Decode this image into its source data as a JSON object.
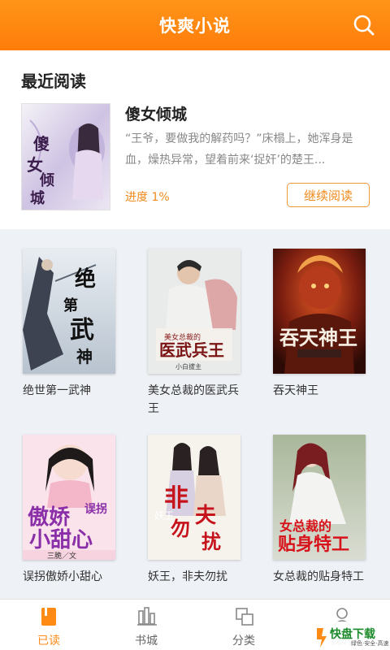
{
  "header": {
    "title": "快爽小说"
  },
  "recent": {
    "heading": "最近阅读",
    "book_title": "傻女倾城",
    "description": "“王爷，要做我的解药吗？”床榻上，她浑身是血，燥热异常，望着前来‘捉奸’的楚王...",
    "progress": "进度 1%",
    "continue_label": "继续阅读",
    "cover_text": "傻女倾城"
  },
  "books": [
    {
      "title": "绝世第一武神",
      "cover_text": "绝世第一武神"
    },
    {
      "title": "美女总裁的医武兵王",
      "cover_text": "医武兵王"
    },
    {
      "title": "吞天神王",
      "cover_text": "吞天神王"
    },
    {
      "title": "误拐傲娇小甜心",
      "cover_text": "傲娇小甜心"
    },
    {
      "title": "妖王，非夫勿扰",
      "cover_text": "非夫勿扰"
    },
    {
      "title": "女总裁的贴身特工",
      "cover_text": "女总裁的贴身特工"
    }
  ],
  "tabs": [
    {
      "label": "已读",
      "icon": "book-icon",
      "active": true
    },
    {
      "label": "书城",
      "icon": "bookshelf-icon",
      "active": false
    },
    {
      "label": "分类",
      "icon": "category-icon",
      "active": false
    },
    {
      "label": "我的",
      "icon": "user-icon",
      "active": false
    }
  ],
  "watermark": {
    "main": "快盘下载",
    "sub": "绿色·安全·高速"
  },
  "colors": {
    "accent": "#ff8a14",
    "header_top": "#ff9419",
    "header_bottom": "#ff7d0a"
  }
}
